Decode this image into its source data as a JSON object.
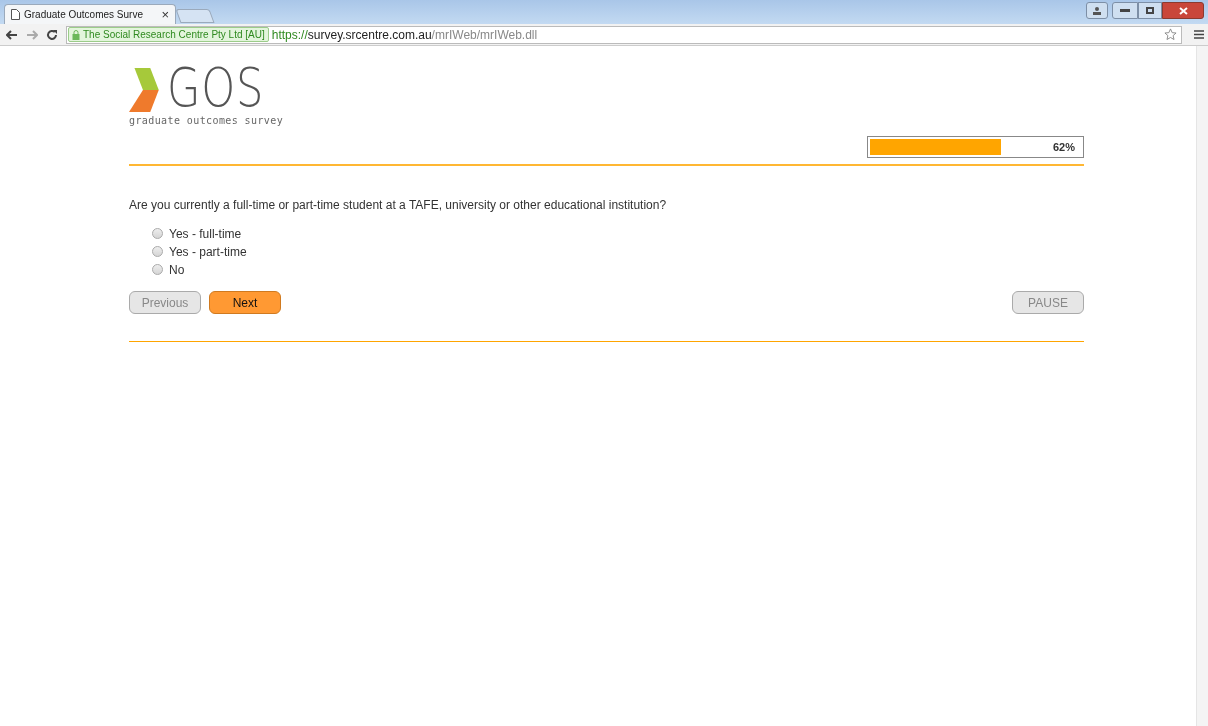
{
  "browser": {
    "tab_title": "Graduate Outcomes Surve",
    "tab_close": "×",
    "security_label": "The Social Research Centre Pty Ltd [AU]",
    "url": [
      {
        "kind": "scheme",
        "text": "https://"
      },
      {
        "kind": "host",
        "text": "survey.srcentre.com.au"
      },
      {
        "kind": "path",
        "text": "/mrIWeb/mrIWeb.dll"
      }
    ]
  },
  "logo": {
    "wordmark": "GOS",
    "tagline": "graduate outcomes survey"
  },
  "progress": {
    "level": 0.62,
    "reading": "62%"
  },
  "question": "Are you currently a full-time or part-time student at a TAFE, university or other educational institution?",
  "options": [
    {
      "label": "Yes - full-time",
      "checked": false
    },
    {
      "label": "Yes - part-time",
      "checked": false
    },
    {
      "label": "No",
      "checked": false
    }
  ],
  "buttons": [
    {
      "kind": "previous",
      "label": "Previous",
      "disabled": true
    },
    {
      "kind": "next",
      "label": "Next",
      "disabled": false
    },
    {
      "kind": "pause",
      "label": "PAUSE",
      "disabled": true
    }
  ]
}
